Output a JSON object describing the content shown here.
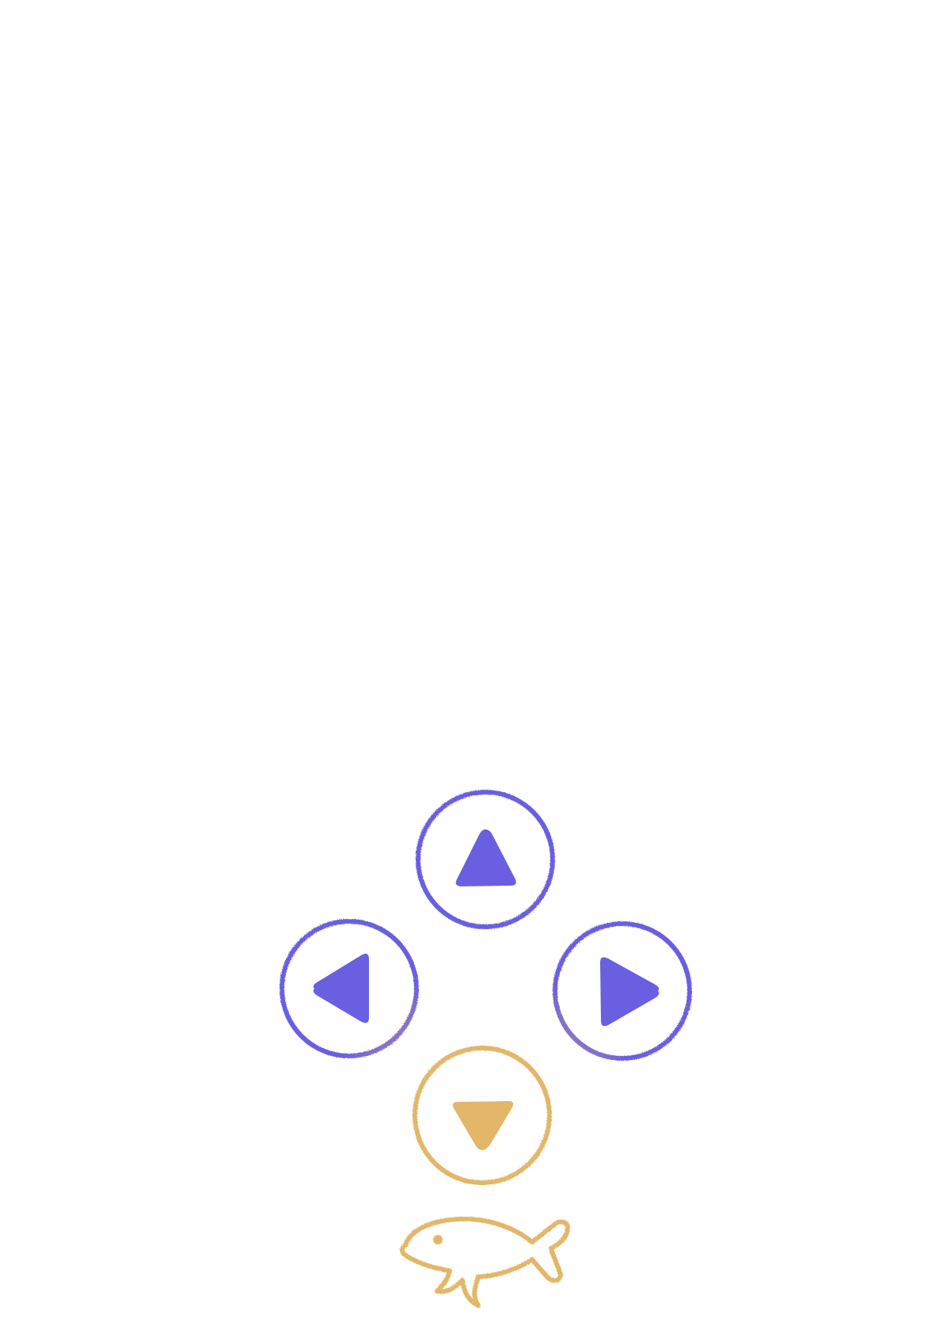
{
  "controls": {
    "up": {
      "icon": "arrow-up-icon",
      "color": "#6a5fe0",
      "state": "idle"
    },
    "left": {
      "icon": "arrow-left-icon",
      "color": "#6a5fe0",
      "state": "idle"
    },
    "right": {
      "icon": "arrow-right-icon",
      "color": "#6a5fe0",
      "state": "idle"
    },
    "down": {
      "icon": "arrow-down-icon",
      "color": "#e2b76a",
      "state": "active"
    }
  },
  "character": {
    "icon": "fish-icon",
    "color": "#e2b76a"
  },
  "colors": {
    "background": "#ffffff",
    "primary": "#6a5fe0",
    "accent": "#e2b76a"
  }
}
